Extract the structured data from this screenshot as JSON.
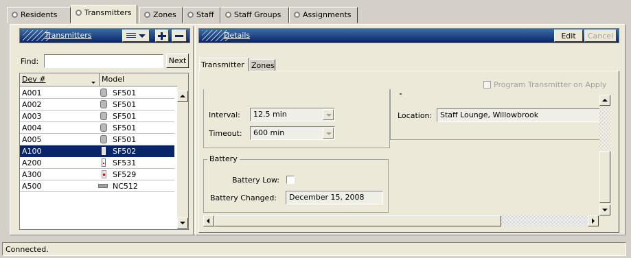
{
  "tabs": [
    "Residents",
    "Transmitters",
    "Zones",
    "Staff",
    "Staff Groups",
    "Assignments"
  ],
  "left_panel": {
    "title": "Transmitters",
    "find_label": "Find:",
    "find_value": "",
    "next_label": "Next",
    "columns": [
      "Dev #",
      "Model"
    ],
    "rows": [
      {
        "dev": "A001",
        "model": "SF501",
        "icon": "pendant-icon"
      },
      {
        "dev": "A002",
        "model": "SF501",
        "icon": "pendant-icon"
      },
      {
        "dev": "A003",
        "model": "SF501",
        "icon": "pendant-icon"
      },
      {
        "dev": "A004",
        "model": "SF501",
        "icon": "pendant-icon"
      },
      {
        "dev": "A005",
        "model": "SF501",
        "icon": "pendant-icon"
      },
      {
        "dev": "A100",
        "model": "SF502",
        "icon": "pendant-icon"
      },
      {
        "dev": "A200",
        "model": "SF531",
        "icon": "pull-cord-icon"
      },
      {
        "dev": "A300",
        "model": "SF529",
        "icon": "red-button-icon"
      },
      {
        "dev": "A500",
        "model": "NC512",
        "icon": "sensor-icon"
      }
    ],
    "selected_row": 5
  },
  "details": {
    "title": "Details",
    "edit_label": "Edit",
    "cancel_label": "Cancel",
    "subtabs": [
      "Transmitter",
      "Zones"
    ],
    "program_label": "Program Transmitter on Apply",
    "interval_label": "Interval:",
    "interval_value": "12.5 min",
    "timeout_label": "Timeout:",
    "timeout_value": "600 min",
    "battery_group": "Battery",
    "battery_low_label": "Battery Low:",
    "battery_changed_label": "Battery Changed:",
    "battery_changed_value": "December 15, 2008",
    "location_label": "Location:",
    "location_value": "Staff Lounge, Willowbrook"
  },
  "status": "Connected.",
  "colors": {
    "selection": "#0a246a",
    "title_blue": "#0a246a",
    "panel": "#ece9d8"
  }
}
